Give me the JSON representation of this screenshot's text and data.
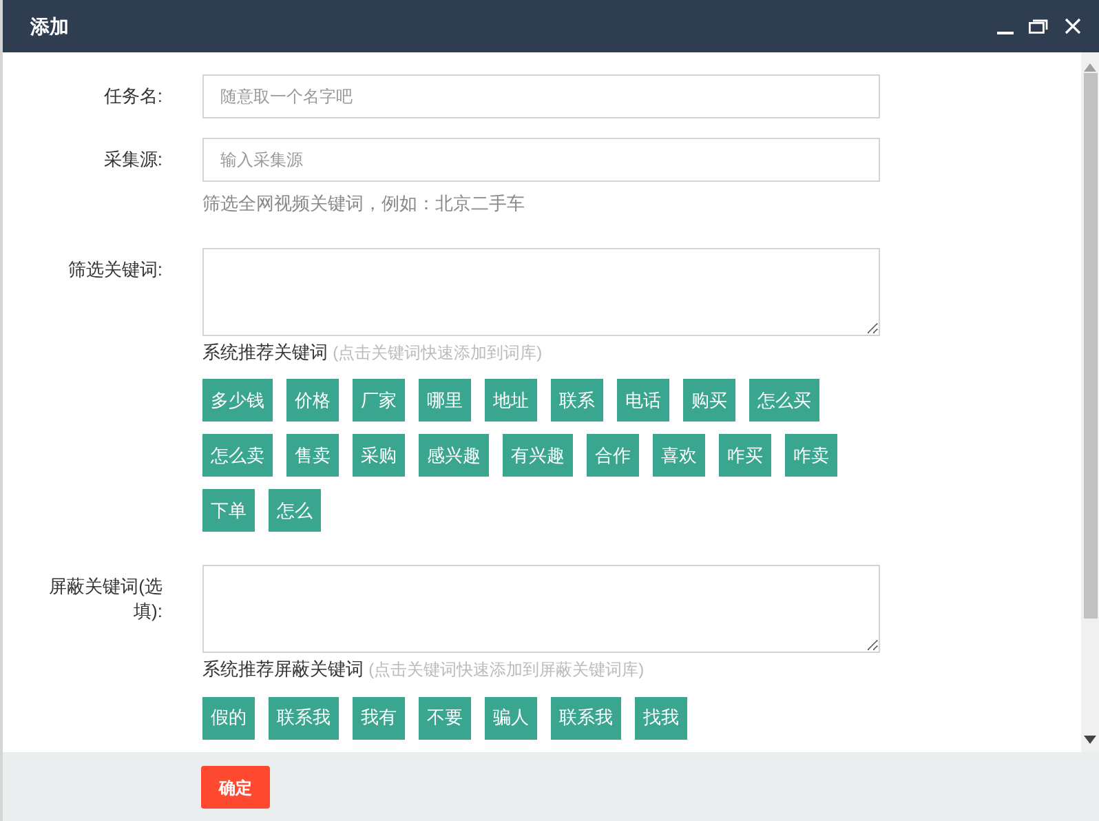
{
  "window": {
    "title": "添加"
  },
  "fields": [
    {
      "kind": "input",
      "label": "任务名:",
      "placeholder": "随意取一个名字吧"
    },
    {
      "kind": "input",
      "label": "采集源:",
      "placeholder": "输入采集源",
      "hint": "筛选全网视频关键词，例如：北京二手车"
    },
    {
      "kind": "textarea",
      "label": "筛选关键词:",
      "recommend_title": "系统推荐关键词",
      "recommend_note": "(点击关键词快速添加到词库)",
      "tags": [
        "多少钱",
        "价格",
        "厂家",
        "哪里",
        "地址",
        "联系",
        "电话",
        "购买",
        "怎么买",
        "怎么卖",
        "售卖",
        "采购",
        "感兴趣",
        "有兴趣",
        "合作",
        "喜欢",
        "咋买",
        "咋卖",
        "下单",
        "怎么"
      ]
    },
    {
      "kind": "textarea",
      "label": "屏蔽关键词(选填):",
      "recommend_title": "系统推荐屏蔽关键词",
      "recommend_note": "(点击关键词快速添加到屏蔽关键词库)",
      "tags": [
        "假的",
        "联系我",
        "我有",
        "不要",
        "骗人",
        "联系我",
        "找我"
      ]
    }
  ],
  "submit": "确定"
}
